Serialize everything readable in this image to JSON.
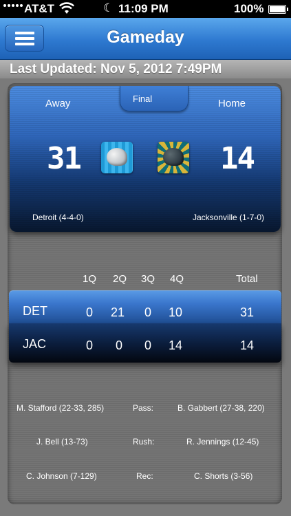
{
  "status_bar": {
    "carrier": "AT&T",
    "time": "11:09 PM",
    "battery_percent": "100%",
    "icons": [
      "signal-icon",
      "wifi-icon",
      "moon-icon",
      "battery-icon"
    ]
  },
  "nav": {
    "title": "Gameday",
    "menu_icon": "hamburger-menu-icon"
  },
  "last_updated": "Last Updated: Nov 5, 2012 7:49PM",
  "game": {
    "status": "Final",
    "away": {
      "label": "Away",
      "score": "31",
      "team": "Detroit (4-4-0)"
    },
    "home": {
      "label": "Home",
      "score": "14",
      "team": "Jacksonville (1-7-0)"
    }
  },
  "linescore": {
    "headers": [
      "1Q",
      "2Q",
      "3Q",
      "4Q",
      "Total"
    ],
    "rows": [
      {
        "team": "DET",
        "q": [
          "0",
          "21",
          "0",
          "10"
        ],
        "total": "31"
      },
      {
        "team": "JAC",
        "q": [
          "0",
          "0",
          "0",
          "14"
        ],
        "total": "14"
      }
    ]
  },
  "leaders": [
    {
      "away": "M. Stafford (22-33, 285)",
      "category": "Pass:",
      "home": "B. Gabbert (27-38, 220)"
    },
    {
      "away": "J. Bell (13-73)",
      "category": "Rush:",
      "home": "R. Jennings (12-45)"
    },
    {
      "away": "C. Johnson (7-129)",
      "category": "Rec:",
      "home": "C. Shorts (3-56)"
    }
  ],
  "colors": {
    "nav_blue": "#2e79d0",
    "card_blue": "#2e65b8",
    "panel_gray": "#747474"
  }
}
